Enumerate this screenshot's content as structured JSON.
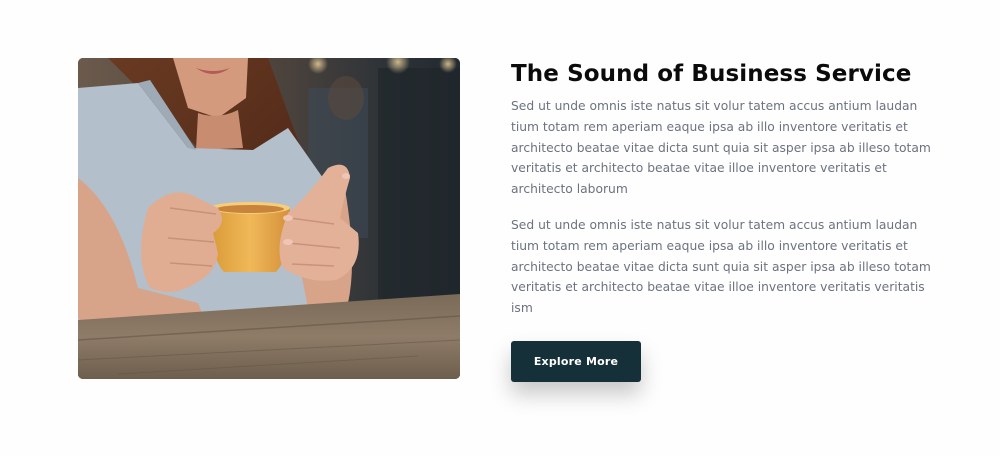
{
  "section": {
    "title": "The Sound of Business Service",
    "paragraph_1_lines": [
      "Sed ut unde omnis iste natus sit volur tatem accus antium laudan",
      "tium totam rem aperiam eaque ipsa ab illo inventore veritatis et",
      "architecto beatae vitae dicta sunt quia sit asper ipsa ab illeso totam",
      "veritatis et architecto beatae vitae illoe inventore veritatis et",
      "architecto laborum"
    ],
    "paragraph_2_lines": [
      "Sed ut unde omnis iste natus sit volur tatem accus antium laudan",
      "tium totam rem aperiam eaque ipsa ab illo inventore veritatis et",
      "architecto beatae vitae dicta sunt quia sit asper ipsa ab illeso totam",
      "veritatis et architecto beatae vitae illoe inventore veritatis veritatis",
      "ism"
    ],
    "button_label": "Explore More"
  },
  "colors": {
    "title": "#0b0b0b",
    "body_text": "#6c727f",
    "button_bg": "#153038",
    "button_text": "#ffffff",
    "page_bg": "#fefefe"
  }
}
